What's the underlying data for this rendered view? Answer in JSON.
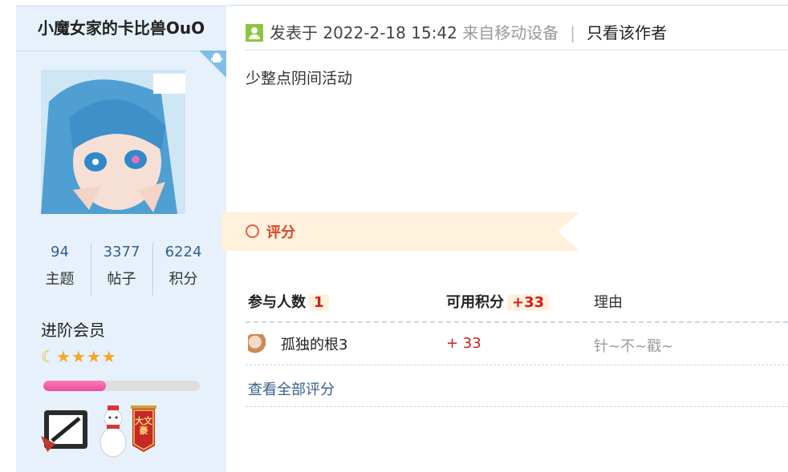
{
  "user": {
    "name": "小魔女家的卡比兽OuO",
    "stats": [
      {
        "value": "94",
        "label": "主题"
      },
      {
        "value": "3377",
        "label": "帖子"
      },
      {
        "value": "6224",
        "label": "积分"
      }
    ],
    "level": "进阶会员",
    "stars": {
      "moon": 1,
      "star": 4
    },
    "progress_fraction": 0.4
  },
  "post": {
    "prefix": "发表于",
    "datetime": "2022-2-18 15:42",
    "source": "来自移动设备",
    "only_author": "只看该作者",
    "content": "少整点阴间活动"
  },
  "rating": {
    "title": "评分",
    "headers": {
      "participants_label": "参与人数",
      "participants_count": "1",
      "points_label": "可用积分",
      "points_value": "+33",
      "reason_label": "理由"
    },
    "rows": [
      {
        "name": "孤独的根3",
        "score": "+ 33",
        "reason": "针~不~戳~"
      }
    ],
    "view_all": "查看全部评分"
  },
  "colors": {
    "accent_blue": "#36608a",
    "score_red": "#d61b1b",
    "progress_pink": "#e64d9b",
    "banner_bg": "#fff1dc"
  },
  "medals": {
    "medal3_text": "大文豪"
  }
}
